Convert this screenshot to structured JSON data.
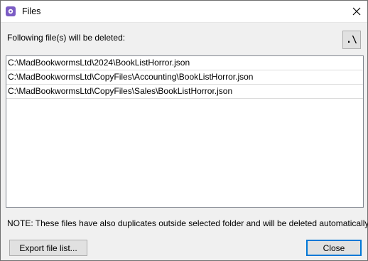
{
  "window": {
    "title": "Files"
  },
  "dialog": {
    "prompt": "Following file(s) will be deleted:",
    "path_button_label": ".\\",
    "files": [
      "C:\\MadBookwormsLtd\\2024\\BookListHorror.json",
      "C:\\MadBookwormsLtd\\CopyFiles\\Accounting\\BookListHorror.json",
      "C:\\MadBookwormsLtd\\CopyFiles\\Sales\\BookListHorror.json"
    ],
    "note": "NOTE: These files have also duplicates outside selected folder and will be deleted automatically.",
    "export_label": "Export file list...",
    "close_label": "Close"
  }
}
